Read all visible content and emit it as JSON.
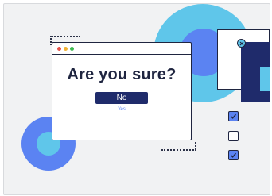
{
  "dialog": {
    "question": "Are you sure?",
    "primary_label": "No",
    "secondary_label": "Yes",
    "window_controls": [
      "close-dot",
      "minimize-dot",
      "maximize-dot"
    ]
  },
  "checkboxes": [
    {
      "checked": true
    },
    {
      "checked": false
    },
    {
      "checked": true
    }
  ],
  "colors": {
    "navy": "#1f2b6b",
    "blue": "#5b83f2",
    "light_blue": "#5fc6ea",
    "background": "#f1f2f3"
  }
}
